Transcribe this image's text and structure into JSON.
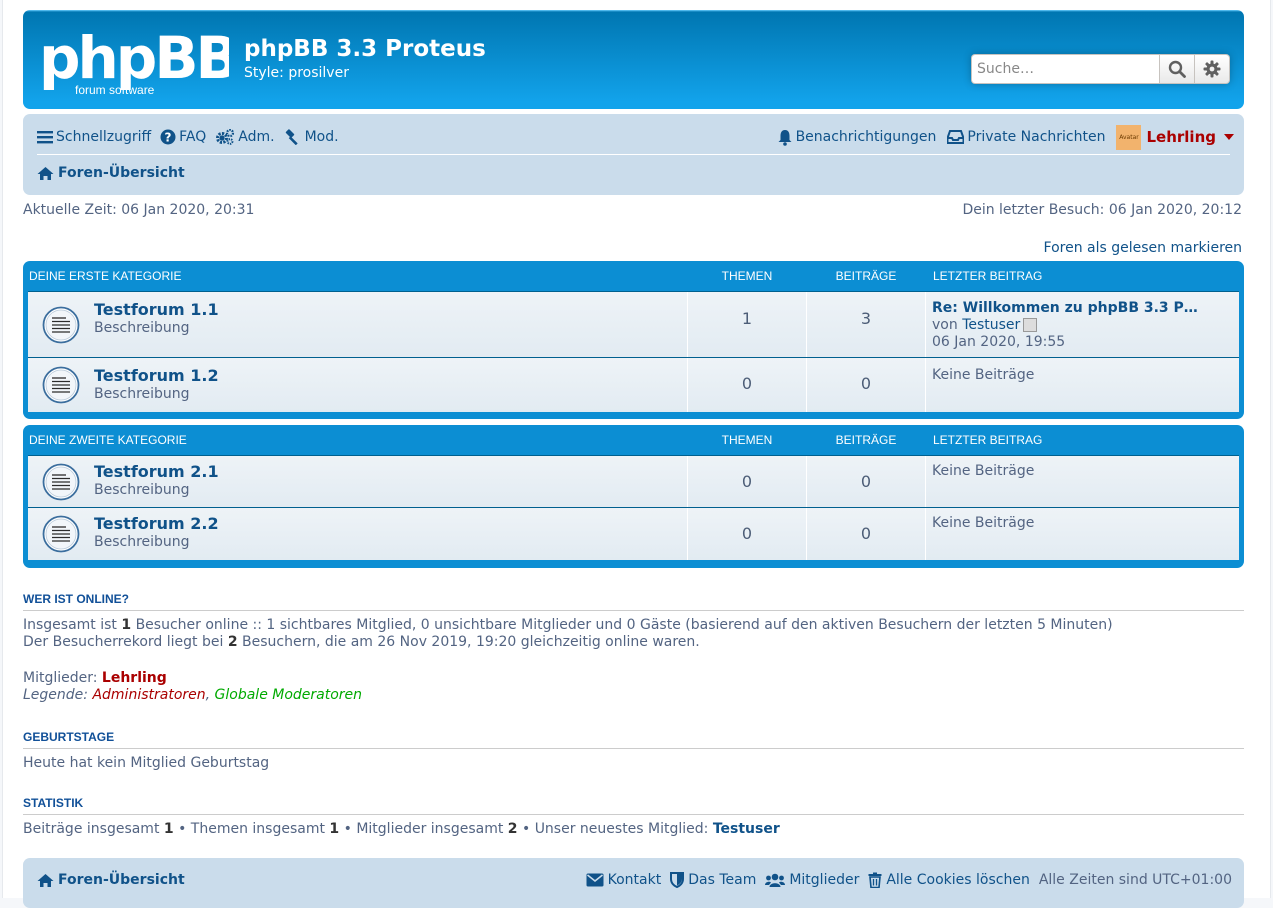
{
  "header": {
    "logo_text": "phpBB",
    "logo_sub": "forum software",
    "site_title": "phpBB 3.3 Proteus",
    "site_desc": "Style: prosilver",
    "search_placeholder": "Suche…"
  },
  "navbar": {
    "quicklinks": "Schnellzugriff",
    "faq": "FAQ",
    "acp": "Adm.",
    "mcp": "Mod.",
    "notifications": "Benachrichtigungen",
    "pm": "Private Nachrichten",
    "avatar_label": "Avatar",
    "username": "Lehrling",
    "breadcrumb": "Foren-Übersicht"
  },
  "time": {
    "current": "Aktuelle Zeit: 06 Jan 2020, 20:31",
    "last_visit": "Dein letzter Besuch: 06 Jan 2020, 20:12",
    "mark_read": "Foren als gelesen markieren"
  },
  "categories": [
    {
      "name": "Deine erste Kategorie",
      "col_topics": "Themen",
      "col_posts": "Beiträge",
      "col_last": "Letzter Beitrag",
      "forums": [
        {
          "title": "Testforum 1.1",
          "desc": "Beschreibung",
          "topics": "1",
          "posts": "3",
          "last_title": "Re: Willkommen zu phpBB 3.3 P…",
          "last_by_prefix": "von ",
          "last_by": "Testuser",
          "last_time": "06 Jan 2020, 19:55"
        },
        {
          "title": "Testforum 1.2",
          "desc": "Beschreibung",
          "topics": "0",
          "posts": "0",
          "last_none": "Keine Beiträge"
        }
      ]
    },
    {
      "name": "Deine zweite Kategorie",
      "col_topics": "Themen",
      "col_posts": "Beiträge",
      "col_last": "Letzter Beitrag",
      "forums": [
        {
          "title": "Testforum 2.1",
          "desc": "Beschreibung",
          "topics": "0",
          "posts": "0",
          "last_none": "Keine Beiträge"
        },
        {
          "title": "Testforum 2.2",
          "desc": "Beschreibung",
          "topics": "0",
          "posts": "0",
          "last_none": "Keine Beiträge"
        }
      ]
    }
  ],
  "online": {
    "heading": "Wer ist online?",
    "line1_a": "Insgesamt ist ",
    "line1_num": "1",
    "line1_b": " Besucher online :: 1 sichtbares Mitglied, 0 unsichtbare Mitglieder und 0 Gäste (basierend auf den aktiven Besuchern der letzten 5 Minuten)",
    "line2_a": "Der Besucherrekord liegt bei ",
    "line2_num": "2",
    "line2_b": " Besuchern, die am 26 Nov 2019, 19:20 gleichzeitig online waren.",
    "members_label": "Mitglieder: ",
    "members_user": "Lehrling",
    "legend_label": "Legende: ",
    "legend_admin": "Administratoren",
    "legend_sep": ", ",
    "legend_gmod": "Globale Moderatoren"
  },
  "birthdays": {
    "heading": "Geburtstage",
    "text": "Heute hat kein Mitglied Geburtstag"
  },
  "stats": {
    "heading": "Statistik",
    "posts_label": "Beiträge insgesamt ",
    "posts": "1",
    "topics_label": " • Themen insgesamt ",
    "topics": "1",
    "members_label": " • Mitglieder insgesamt ",
    "members": "2",
    "newest_label": " • Unser neuestes Mitglied: ",
    "newest": "Testuser"
  },
  "footer": {
    "breadcrumb": "Foren-Übersicht",
    "contact": "Kontakt",
    "team": "Das Team",
    "members": "Mitglieder",
    "cookies": "Alle Cookies löschen",
    "timezone": "Alle Zeiten sind UTC+01:00"
  }
}
